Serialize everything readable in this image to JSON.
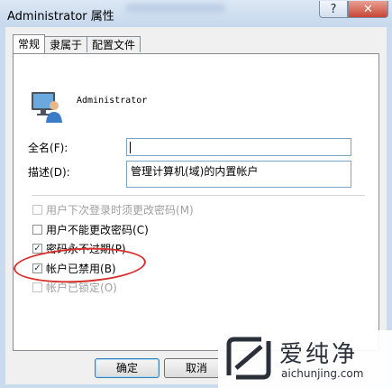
{
  "window": {
    "title": "Administrator 属性",
    "help_label": "?",
    "close_label": "✕"
  },
  "tabs": [
    {
      "label": "常规",
      "active": true
    },
    {
      "label": "隶属于",
      "active": false
    },
    {
      "label": "配置文件",
      "active": false
    }
  ],
  "general": {
    "username": "Administrator",
    "icon": "user-monitor-icon",
    "fullname_label": "全名",
    "fullname_key": "(F):",
    "fullname_value": "",
    "description_label": "描述",
    "description_key": "(D):",
    "description_value": "管理计算机(域)的内置帐户"
  },
  "checkboxes": [
    {
      "label": "用户下次登录时须更改密码",
      "key": "(M)",
      "checked": false,
      "enabled": false
    },
    {
      "label": "用户不能更改密码",
      "key": "(C)",
      "checked": false,
      "enabled": true
    },
    {
      "label": "密码永不过期",
      "key": "(P)",
      "checked": true,
      "enabled": true
    },
    {
      "label": "帐户已禁用",
      "key": "(B)",
      "checked": true,
      "enabled": true
    },
    {
      "label": "帐户已锁定",
      "key": "(O)",
      "checked": false,
      "enabled": false
    }
  ],
  "buttons": {
    "ok": "确定",
    "cancel": "取消"
  },
  "watermark": {
    "brand": "爱纯净",
    "url": "aichunjing.com"
  },
  "colors": {
    "highlight_oval": "#d6302d",
    "checkmark": "#1c3e6b"
  }
}
